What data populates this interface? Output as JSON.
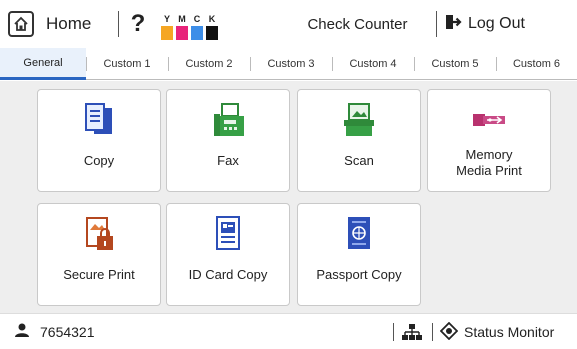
{
  "topbar": {
    "home_label": "Home",
    "help_label": "?",
    "check_counter_label": "Check Counter",
    "logout_label": "Log Out",
    "ink": [
      {
        "letter": "Y",
        "color": "#f5a623"
      },
      {
        "letter": "M",
        "color": "#e8247a"
      },
      {
        "letter": "C",
        "color": "#3d8ee8"
      },
      {
        "letter": "K",
        "color": "#111111"
      }
    ]
  },
  "tabs": [
    {
      "label": "General",
      "active": true
    },
    {
      "label": "Custom 1",
      "active": false
    },
    {
      "label": "Custom 2",
      "active": false
    },
    {
      "label": "Custom 3",
      "active": false
    },
    {
      "label": "Custom 4",
      "active": false
    },
    {
      "label": "Custom 5",
      "active": false
    },
    {
      "label": "Custom 6",
      "active": false
    }
  ],
  "tiles": [
    {
      "label": "Copy",
      "icon": "copy-icon"
    },
    {
      "label": "Fax",
      "icon": "fax-icon"
    },
    {
      "label": "Scan",
      "icon": "scan-icon"
    },
    {
      "label": "Memory\nMedia Print",
      "label_line1": "Memory",
      "label_line2": "Media Print",
      "icon": "usb-memory-icon"
    },
    {
      "label": "Secure Print",
      "icon": "secure-print-icon"
    },
    {
      "label": "ID Card Copy",
      "icon": "id-card-icon"
    },
    {
      "label": "Passport Copy",
      "icon": "passport-icon"
    }
  ],
  "bottombar": {
    "user_id": "7654321",
    "status_monitor_label": "Status Monitor"
  },
  "colors": {
    "accent": "#2a66c2",
    "tab_active_bg": "#e9f1fb",
    "panel_bg": "#eeeeee"
  }
}
